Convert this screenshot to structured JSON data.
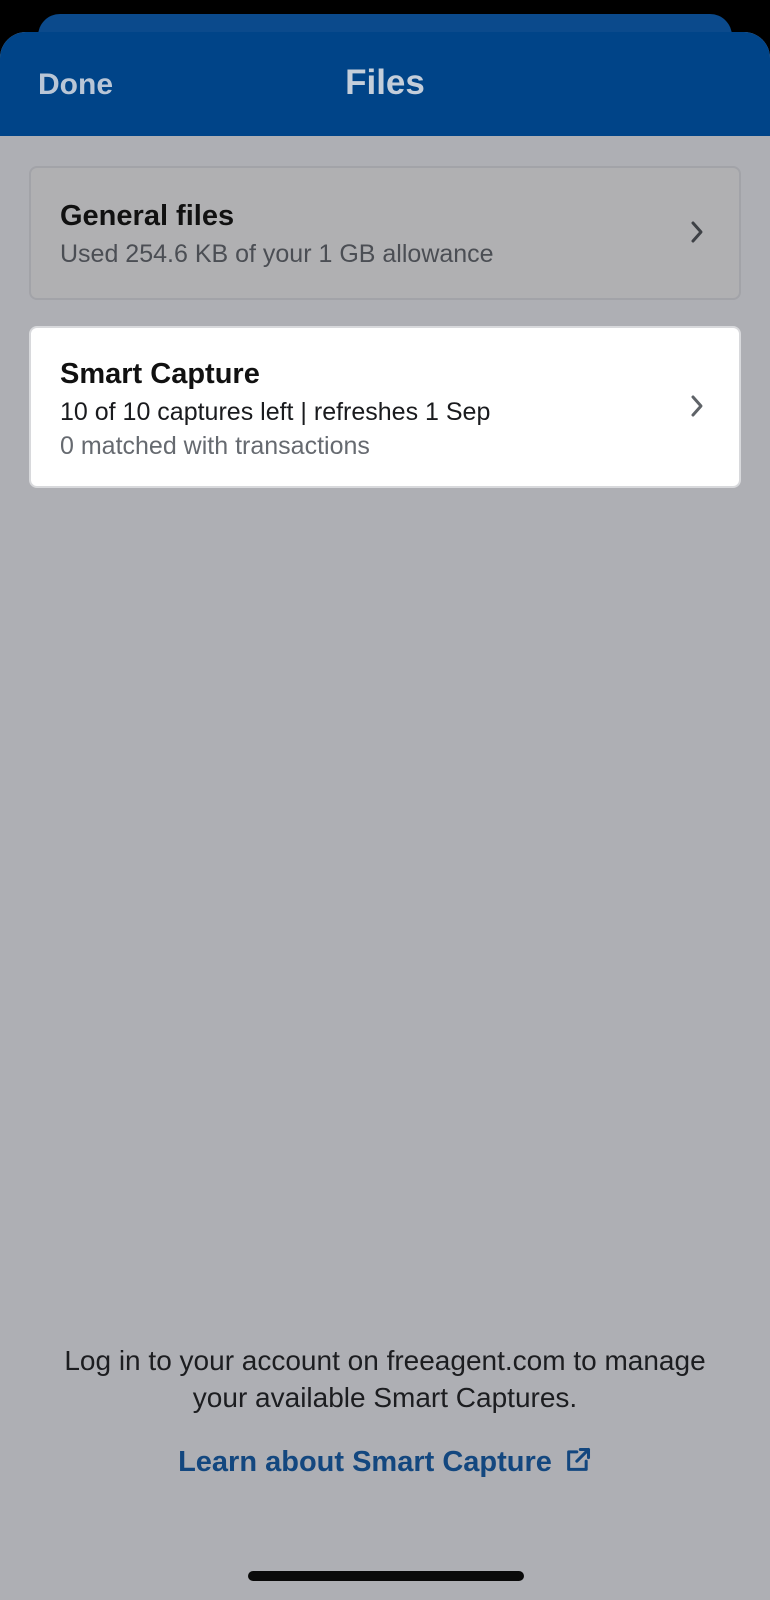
{
  "header": {
    "done_label": "Done",
    "title": "Files"
  },
  "cards": {
    "general": {
      "title": "General files",
      "subtitle": "Used 254.6 KB of your 1 GB allowance"
    },
    "smart_capture": {
      "title": "Smart Capture",
      "line1": "10 of 10 captures left | refreshes 1 Sep",
      "line2": "0 matched with transactions"
    }
  },
  "footer": {
    "message": "Log in to your account on freeagent.com to manage your available Smart Captures.",
    "link_label": "Learn about Smart Capture"
  },
  "icons": {
    "row_chevron": "chevron-right-icon",
    "link_icon": "external-link-icon"
  },
  "colors": {
    "navbar": "#004488",
    "backdrop": "#aeafb4",
    "link": "#13477f"
  }
}
